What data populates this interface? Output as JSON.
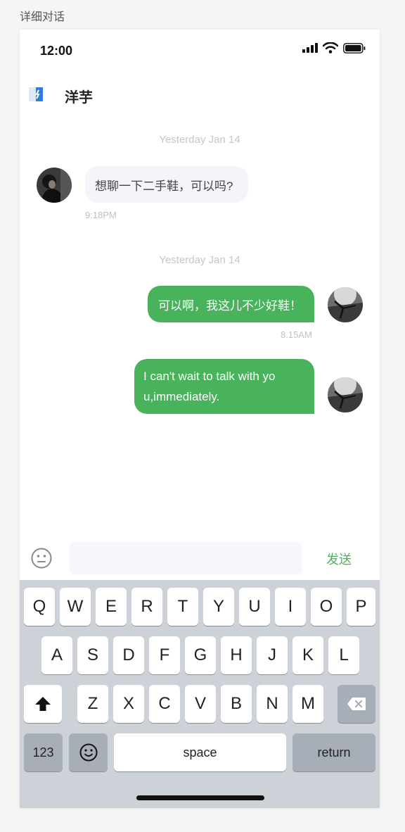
{
  "page_label": "详细对话",
  "status_bar": {
    "time": "12:00"
  },
  "header": {
    "contact_name": "洋芋"
  },
  "messages": {
    "date_1": "Yesterday Jan 14",
    "incoming_1": {
      "text": "想聊一下二手鞋，可以吗?",
      "time": "9:18PM"
    },
    "date_2": "Yesterday Jan 14",
    "outgoing_1": {
      "text": "可以啊，我这儿不少好鞋！",
      "time": "8.15AM"
    },
    "outgoing_2": {
      "line1": "I can't wait to talk with yo",
      "line2": "u,immediately."
    }
  },
  "input_bar": {
    "placeholder": "",
    "send_label": "发送"
  },
  "keyboard": {
    "row1": [
      "Q",
      "W",
      "E",
      "R",
      "T",
      "Y",
      "U",
      "I",
      "O",
      "P"
    ],
    "row2": [
      "A",
      "S",
      "D",
      "F",
      "G",
      "H",
      "J",
      "K",
      "L"
    ],
    "row3": [
      "Z",
      "X",
      "C",
      "V",
      "B",
      "N",
      "M"
    ],
    "num_label": "123",
    "space_label": "space",
    "return_label": "return"
  },
  "colors": {
    "accent_green": "#48b35b",
    "bubble_in": "#f3f5fb",
    "keyboard_bg": "#cdd1d8"
  },
  "icons": [
    "back-icon",
    "signal-icon",
    "wifi-icon",
    "battery-icon",
    "emoji-icon",
    "shift-icon",
    "backspace-icon",
    "keyboard-emoji-icon"
  ]
}
